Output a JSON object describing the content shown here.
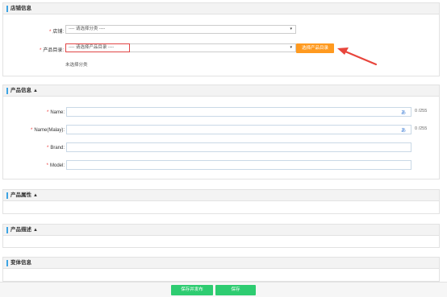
{
  "store_info": {
    "title": "店铺信息",
    "store_label": "店铺:",
    "store_select": "---- 请选择分类 ----",
    "catalog_label": "产品目录:",
    "catalog_select": "---- 请选择产品目录 ----",
    "catalog_button": "选择产品目录",
    "unselected_hint": "未选择分类"
  },
  "product_info": {
    "title": "产品信息",
    "name_label": "Name:",
    "name_value": "",
    "name_count": "0 /255",
    "name_malay_label": "Name(Malay):",
    "name_malay_value": "",
    "name_malay_count": "0 /255",
    "brand_label": "Brand:",
    "brand_value": "",
    "model_label": "Model:",
    "model_value": "",
    "translate_icon": "translate-icon"
  },
  "product_attributes": {
    "title": "产品属性"
  },
  "product_description": {
    "title": "产品描述"
  },
  "variant_info": {
    "title": "变体信息"
  },
  "footer": {
    "save_publish": "保存并发布",
    "save": "保存"
  },
  "colors": {
    "accent_bar": "#3da4e3",
    "orange_button": "#ff9a1f",
    "green_button": "#2ecc71",
    "required_star": "#ee3333",
    "arrow": "#e8453c"
  }
}
